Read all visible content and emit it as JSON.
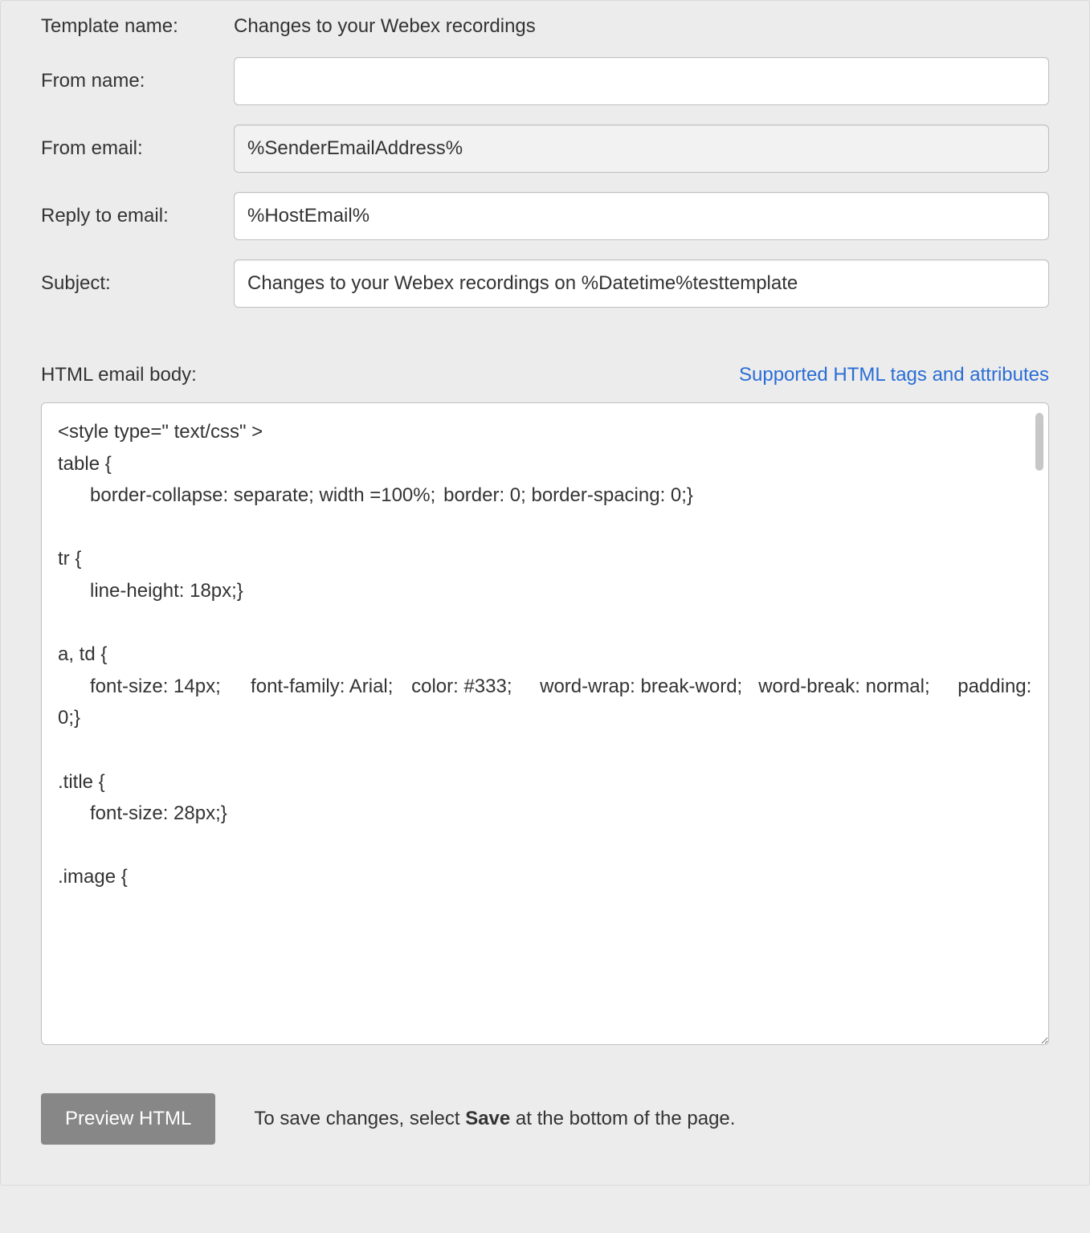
{
  "labels": {
    "template_name": "Template name:",
    "from_name": "From name:",
    "from_email": "From email:",
    "reply_to_email": "Reply to email:",
    "subject": "Subject:",
    "html_email_body": "HTML email body:"
  },
  "values": {
    "template_name": "Changes to your Webex recordings",
    "from_name": "",
    "from_email": "%SenderEmailAddress%",
    "reply_to_email": "%HostEmail%",
    "subject": "Changes to your Webex recordings on %Datetime%testtemplate",
    "html_body": "<style type=\" text/css\" >\ntable {\n\tborder-collapse: separate; width =100%;\tborder: 0; border-spacing: 0;}\n\ntr {\n\tline-height: 18px;}\n\na, td {\n\tfont-size: 14px;\tfont-family: Arial;\tcolor: #333;\tword-wrap: break-word;   word-break: normal;\tpadding: 0;}\n\n.title {\n\tfont-size: 28px;}\n\n.image {"
  },
  "link": {
    "supported_tags": "Supported HTML tags and attributes"
  },
  "buttons": {
    "preview_html": "Preview HTML"
  },
  "hints": {
    "save_pre": "To save changes, select ",
    "save_bold": "Save",
    "save_post": " at the bottom of the page."
  }
}
